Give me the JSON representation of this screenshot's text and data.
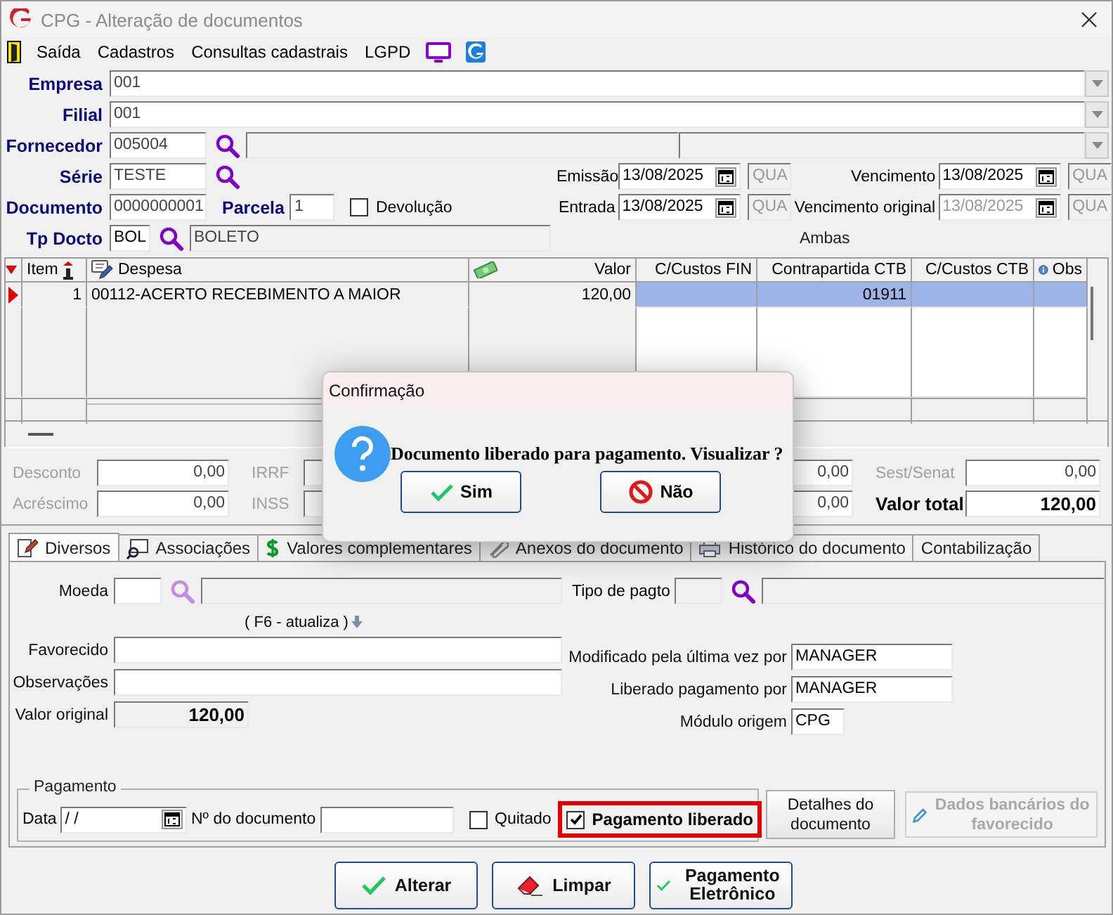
{
  "window": {
    "title": "CPG - Alteração de documentos"
  },
  "menu": [
    {
      "label": "Saída"
    },
    {
      "label": "Cadastros"
    },
    {
      "label": "Consultas cadastrais"
    },
    {
      "label": "LGPD"
    }
  ],
  "header": {
    "empresa": {
      "label": "Empresa",
      "value": "001"
    },
    "filial": {
      "label": "Filial",
      "value": "001"
    },
    "fornecedor": {
      "label": "Fornecedor",
      "value": "005004"
    },
    "serie": {
      "label": "Série",
      "value": "TESTE"
    },
    "documento": {
      "label": "Documento",
      "value": "0000000001"
    },
    "parcela": {
      "label": "Parcela",
      "value": "1"
    },
    "devolucao": {
      "label": "Devolução",
      "checked": false
    },
    "tp_docto": {
      "label": "Tp Docto",
      "value": "BOL",
      "description": "BOLETO"
    },
    "dates": [
      {
        "label": "Emissão",
        "value": "13/08/2025",
        "weekday": "QUA",
        "disabled": false
      },
      {
        "label": "Vencimento",
        "value": "13/08/2025",
        "weekday": "QUA",
        "disabled": false
      },
      {
        "label": "Entrada",
        "value": "13/08/2025",
        "weekday": "QUA",
        "disabled": false
      },
      {
        "label": "Vencimento original",
        "value": "13/08/2025",
        "weekday": "QUA",
        "disabled": true
      }
    ],
    "ambas": "Ambas"
  },
  "grid": {
    "columns": [
      "Item",
      "Despesa",
      "Valor",
      "C/Custos FIN",
      "Contrapartida CTB",
      "C/Custos CTB",
      "Obs"
    ],
    "rows": [
      {
        "selected": true,
        "item": "1",
        "despesa": "00112-ACERTO RECEBIMENTO A MAIOR",
        "valor": "120,00",
        "contrapartida_ctb": "01911"
      }
    ]
  },
  "totals": [
    [
      {
        "label": "Desconto",
        "value": "0,00",
        "kind": "plain"
      },
      {
        "label": "Acréscimo",
        "value": "0,00",
        "kind": "plain"
      }
    ],
    [
      {
        "label": "IRRF",
        "kind": "plain"
      },
      {
        "label": "INSS",
        "kind": "plain"
      }
    ],
    [
      {
        "value": "0,00",
        "kind": "plain"
      },
      {
        "value": "0,00",
        "kind": "plain"
      }
    ],
    [
      {
        "label": "Sest/Senat",
        "value": "0,00",
        "kind": "plain"
      },
      {
        "label": "Valor total",
        "value": "120,00",
        "kind": "total"
      }
    ]
  ],
  "tabs": [
    {
      "label": "Diversos",
      "selected": true,
      "kind": "pencil"
    },
    {
      "label": "Associações",
      "selected": false,
      "kind": "search"
    },
    {
      "label": "Valores complementares",
      "selected": false,
      "kind": "dollar"
    },
    {
      "label": "Anexos do documento",
      "selected": false,
      "kind": "clip"
    },
    {
      "label": "Histórico do documento",
      "selected": false,
      "kind": "printer"
    },
    {
      "label": "Contabilização",
      "selected": false,
      "kind": "none"
    }
  ],
  "diversos": {
    "moeda": {
      "label": "Moeda"
    },
    "tipo_pagto": {
      "label": "Tipo de pagto"
    },
    "f6_hint": "( F6 - atualiza )",
    "favorecido": {
      "label": "Favorecido"
    },
    "observacoes": {
      "label": "Observações"
    },
    "valor_original": {
      "label": "Valor original",
      "value": "120,00"
    },
    "modificado_por": {
      "label": "Modificado pela última vez por",
      "value": "MANAGER"
    },
    "liberado_por": {
      "label": "Liberado pagamento por",
      "value": "MANAGER"
    },
    "modulo_origem": {
      "label": "Módulo origem",
      "value": "CPG"
    }
  },
  "pagamento": {
    "legend": "Pagamento",
    "data": {
      "label": "Data",
      "value": "/ /"
    },
    "documento": {
      "label": "Nº do documento"
    },
    "quitado": {
      "label": "Quitado",
      "checked": false
    },
    "liberado": {
      "label": "Pagamento liberado",
      "checked": true,
      "highlighted": true
    },
    "detalhes_button": {
      "label": "Detalhes do documento"
    },
    "dados_bancarios_button": {
      "label": "Dados bancários do favorecido",
      "disabled": true
    }
  },
  "actions": [
    {
      "label": "Alterar",
      "kind": "check"
    },
    {
      "label": "Limpar",
      "kind": "eraser"
    },
    {
      "label": "Pagamento Eletrônico",
      "kind": "check"
    }
  ],
  "dialog": {
    "title": "Confirmação",
    "message": "Documento liberado para pagamento. Visualizar ?",
    "buttons": [
      {
        "label": "Sim",
        "kind": "yes"
      },
      {
        "label": "Não",
        "kind": "no"
      }
    ]
  }
}
